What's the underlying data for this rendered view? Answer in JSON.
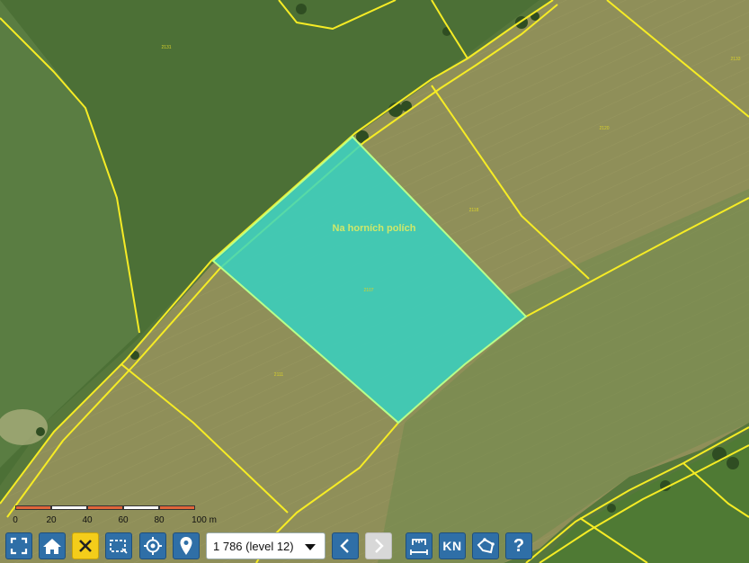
{
  "map": {
    "place_name": "Na horních polích",
    "parcel_numbers": [
      "2131",
      "2133",
      "2120",
      "2118",
      "2107",
      "2111"
    ],
    "colors": {
      "parcel_boundary": "#f6ec25",
      "selected_parcel_fill": "#2fd6c8",
      "selected_parcel_outline": "#b8ff8a",
      "place_name_text": "#cfe86a"
    }
  },
  "scale": {
    "labels": [
      "0",
      "20",
      "40",
      "60",
      "80",
      "100 m"
    ]
  },
  "toolbar": {
    "zoom_level": "1 786 (level 12)",
    "kn_label": "KN",
    "help_label": "?",
    "colors": {
      "button": "#2f6fa7",
      "active": "#f4cd1a",
      "disabled": "#d8d8d8"
    },
    "buttons": [
      {
        "name": "fullscreen-icon"
      },
      {
        "name": "home-icon"
      },
      {
        "name": "close-icon"
      },
      {
        "name": "select-rectangle-icon"
      },
      {
        "name": "locate-gps-icon"
      },
      {
        "name": "map-pin-icon"
      },
      {
        "name": "chevron-left-icon"
      },
      {
        "name": "chevron-right-icon"
      },
      {
        "name": "measure-icon"
      },
      {
        "name": "kn-layer-icon"
      },
      {
        "name": "area-measure-icon"
      },
      {
        "name": "help-icon"
      }
    ]
  }
}
